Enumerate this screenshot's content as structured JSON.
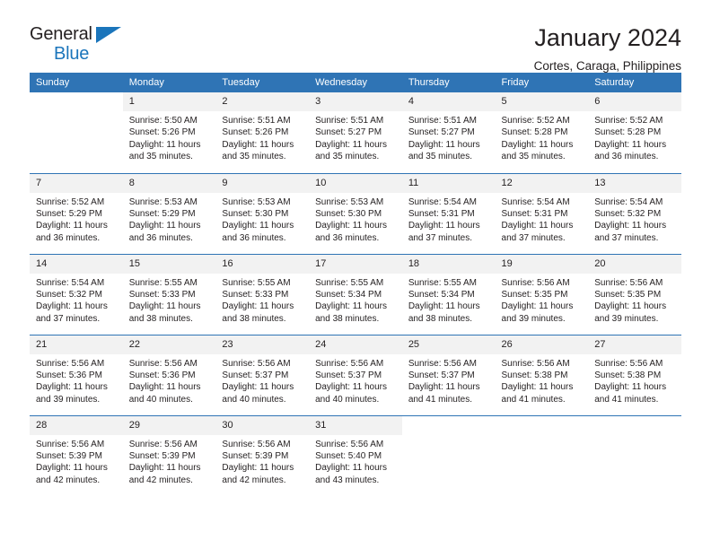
{
  "brand": {
    "name_top": "General",
    "name_bottom": "Blue",
    "triangle_color": "#1b75bb"
  },
  "header": {
    "title": "January 2024",
    "subtitle": "Cortes, Caraga, Philippines"
  },
  "theme": {
    "header_row_bg": "#2f74b5",
    "header_row_text": "#ffffff",
    "daynum_bg": "#f2f2f2",
    "cell_border": "#2f74b5",
    "text": "#231f20"
  },
  "weekday_headers": [
    "Sunday",
    "Monday",
    "Tuesday",
    "Wednesday",
    "Thursday",
    "Friday",
    "Saturday"
  ],
  "weeks": [
    [
      {
        "day": "",
        "sunrise": "",
        "sunset": "",
        "daylight": ""
      },
      {
        "day": "1",
        "sunrise": "Sunrise: 5:50 AM",
        "sunset": "Sunset: 5:26 PM",
        "daylight": "Daylight: 11 hours and 35 minutes."
      },
      {
        "day": "2",
        "sunrise": "Sunrise: 5:51 AM",
        "sunset": "Sunset: 5:26 PM",
        "daylight": "Daylight: 11 hours and 35 minutes."
      },
      {
        "day": "3",
        "sunrise": "Sunrise: 5:51 AM",
        "sunset": "Sunset: 5:27 PM",
        "daylight": "Daylight: 11 hours and 35 minutes."
      },
      {
        "day": "4",
        "sunrise": "Sunrise: 5:51 AM",
        "sunset": "Sunset: 5:27 PM",
        "daylight": "Daylight: 11 hours and 35 minutes."
      },
      {
        "day": "5",
        "sunrise": "Sunrise: 5:52 AM",
        "sunset": "Sunset: 5:28 PM",
        "daylight": "Daylight: 11 hours and 35 minutes."
      },
      {
        "day": "6",
        "sunrise": "Sunrise: 5:52 AM",
        "sunset": "Sunset: 5:28 PM",
        "daylight": "Daylight: 11 hours and 36 minutes."
      }
    ],
    [
      {
        "day": "7",
        "sunrise": "Sunrise: 5:52 AM",
        "sunset": "Sunset: 5:29 PM",
        "daylight": "Daylight: 11 hours and 36 minutes."
      },
      {
        "day": "8",
        "sunrise": "Sunrise: 5:53 AM",
        "sunset": "Sunset: 5:29 PM",
        "daylight": "Daylight: 11 hours and 36 minutes."
      },
      {
        "day": "9",
        "sunrise": "Sunrise: 5:53 AM",
        "sunset": "Sunset: 5:30 PM",
        "daylight": "Daylight: 11 hours and 36 minutes."
      },
      {
        "day": "10",
        "sunrise": "Sunrise: 5:53 AM",
        "sunset": "Sunset: 5:30 PM",
        "daylight": "Daylight: 11 hours and 36 minutes."
      },
      {
        "day": "11",
        "sunrise": "Sunrise: 5:54 AM",
        "sunset": "Sunset: 5:31 PM",
        "daylight": "Daylight: 11 hours and 37 minutes."
      },
      {
        "day": "12",
        "sunrise": "Sunrise: 5:54 AM",
        "sunset": "Sunset: 5:31 PM",
        "daylight": "Daylight: 11 hours and 37 minutes."
      },
      {
        "day": "13",
        "sunrise": "Sunrise: 5:54 AM",
        "sunset": "Sunset: 5:32 PM",
        "daylight": "Daylight: 11 hours and 37 minutes."
      }
    ],
    [
      {
        "day": "14",
        "sunrise": "Sunrise: 5:54 AM",
        "sunset": "Sunset: 5:32 PM",
        "daylight": "Daylight: 11 hours and 37 minutes."
      },
      {
        "day": "15",
        "sunrise": "Sunrise: 5:55 AM",
        "sunset": "Sunset: 5:33 PM",
        "daylight": "Daylight: 11 hours and 38 minutes."
      },
      {
        "day": "16",
        "sunrise": "Sunrise: 5:55 AM",
        "sunset": "Sunset: 5:33 PM",
        "daylight": "Daylight: 11 hours and 38 minutes."
      },
      {
        "day": "17",
        "sunrise": "Sunrise: 5:55 AM",
        "sunset": "Sunset: 5:34 PM",
        "daylight": "Daylight: 11 hours and 38 minutes."
      },
      {
        "day": "18",
        "sunrise": "Sunrise: 5:55 AM",
        "sunset": "Sunset: 5:34 PM",
        "daylight": "Daylight: 11 hours and 38 minutes."
      },
      {
        "day": "19",
        "sunrise": "Sunrise: 5:56 AM",
        "sunset": "Sunset: 5:35 PM",
        "daylight": "Daylight: 11 hours and 39 minutes."
      },
      {
        "day": "20",
        "sunrise": "Sunrise: 5:56 AM",
        "sunset": "Sunset: 5:35 PM",
        "daylight": "Daylight: 11 hours and 39 minutes."
      }
    ],
    [
      {
        "day": "21",
        "sunrise": "Sunrise: 5:56 AM",
        "sunset": "Sunset: 5:36 PM",
        "daylight": "Daylight: 11 hours and 39 minutes."
      },
      {
        "day": "22",
        "sunrise": "Sunrise: 5:56 AM",
        "sunset": "Sunset: 5:36 PM",
        "daylight": "Daylight: 11 hours and 40 minutes."
      },
      {
        "day": "23",
        "sunrise": "Sunrise: 5:56 AM",
        "sunset": "Sunset: 5:37 PM",
        "daylight": "Daylight: 11 hours and 40 minutes."
      },
      {
        "day": "24",
        "sunrise": "Sunrise: 5:56 AM",
        "sunset": "Sunset: 5:37 PM",
        "daylight": "Daylight: 11 hours and 40 minutes."
      },
      {
        "day": "25",
        "sunrise": "Sunrise: 5:56 AM",
        "sunset": "Sunset: 5:37 PM",
        "daylight": "Daylight: 11 hours and 41 minutes."
      },
      {
        "day": "26",
        "sunrise": "Sunrise: 5:56 AM",
        "sunset": "Sunset: 5:38 PM",
        "daylight": "Daylight: 11 hours and 41 minutes."
      },
      {
        "day": "27",
        "sunrise": "Sunrise: 5:56 AM",
        "sunset": "Sunset: 5:38 PM",
        "daylight": "Daylight: 11 hours and 41 minutes."
      }
    ],
    [
      {
        "day": "28",
        "sunrise": "Sunrise: 5:56 AM",
        "sunset": "Sunset: 5:39 PM",
        "daylight": "Daylight: 11 hours and 42 minutes."
      },
      {
        "day": "29",
        "sunrise": "Sunrise: 5:56 AM",
        "sunset": "Sunset: 5:39 PM",
        "daylight": "Daylight: 11 hours and 42 minutes."
      },
      {
        "day": "30",
        "sunrise": "Sunrise: 5:56 AM",
        "sunset": "Sunset: 5:39 PM",
        "daylight": "Daylight: 11 hours and 42 minutes."
      },
      {
        "day": "31",
        "sunrise": "Sunrise: 5:56 AM",
        "sunset": "Sunset: 5:40 PM",
        "daylight": "Daylight: 11 hours and 43 minutes."
      },
      {
        "day": "",
        "sunrise": "",
        "sunset": "",
        "daylight": ""
      },
      {
        "day": "",
        "sunrise": "",
        "sunset": "",
        "daylight": ""
      },
      {
        "day": "",
        "sunrise": "",
        "sunset": "",
        "daylight": ""
      }
    ]
  ]
}
